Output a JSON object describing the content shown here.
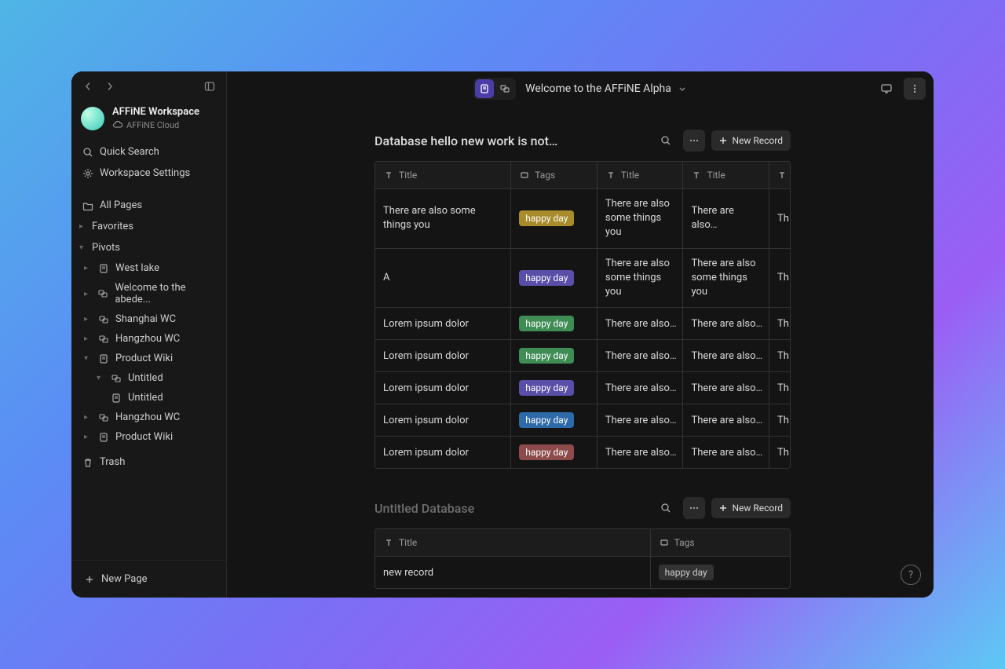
{
  "workspace": {
    "name": "AFFiNE Workspace",
    "sub": "AFFiNE Cloud"
  },
  "sidebar": {
    "quick_search": "Quick Search",
    "settings": "Workspace Settings",
    "all_pages": "All Pages",
    "favorites": "Favorites",
    "pivots": "Pivots",
    "pivot_items": [
      {
        "label": "West lake",
        "icon": "doc"
      },
      {
        "label": "Welcome to the abede...",
        "icon": "edgeless"
      },
      {
        "label": "Shanghai WC",
        "icon": "edgeless"
      },
      {
        "label": "Hangzhou WC",
        "icon": "edgeless"
      },
      {
        "label": "Product Wiki",
        "icon": "doc",
        "expanded": true,
        "children": [
          {
            "label": "Untitled",
            "icon": "edgeless"
          },
          {
            "label": "Untitled",
            "icon": "doc"
          }
        ]
      },
      {
        "label": "Hangzhou WC",
        "icon": "edgeless"
      },
      {
        "label": "Product Wiki",
        "icon": "doc"
      }
    ],
    "trash": "Trash",
    "new_page": "New Page"
  },
  "topbar": {
    "title": "Welcome to the AFFiNE Alpha"
  },
  "db1": {
    "title": "Database hello new work is not…",
    "new_record": "New Record",
    "columns": [
      "Title",
      "Tags",
      "Title",
      "Title",
      "Th"
    ],
    "col_types": [
      "text",
      "tag",
      "text",
      "text",
      "text"
    ],
    "rows": [
      {
        "c0": "There are also some things you",
        "tag": "happy day",
        "tag_color": "#a88b2a",
        "c2": "There are also some things you",
        "c3": "There are also…",
        "c4": "Th"
      },
      {
        "c0": "A",
        "tag": "happy day",
        "tag_color": "#5a4fa8",
        "c2": "There are also some things you",
        "c3": "There are also some things you",
        "c4": "Th"
      },
      {
        "c0": "Lorem ipsum dolor",
        "tag": "happy day",
        "tag_color": "#3f8d55",
        "c2": "There are also…",
        "c3": "There are also…",
        "c4": "Th"
      },
      {
        "c0": "Lorem ipsum dolor",
        "tag": "happy day",
        "tag_color": "#3f8d55",
        "c2": "There are also…",
        "c3": "There are also…",
        "c4": "Th"
      },
      {
        "c0": "Lorem ipsum dolor",
        "tag": "happy day",
        "tag_color": "#5a4fa8",
        "c2": "There are also…",
        "c3": "There are also…",
        "c4": "Th"
      },
      {
        "c0": "Lorem ipsum dolor",
        "tag": "happy day",
        "tag_color": "#2e6aa8",
        "c2": "There are also…",
        "c3": "There are also…",
        "c4": "Th"
      },
      {
        "c0": "Lorem ipsum dolor",
        "tag": "happy day",
        "tag_color": "#8d4a4a",
        "c2": "There are also…",
        "c3": "There are also…",
        "c4": "Th"
      }
    ]
  },
  "db2": {
    "title": "Untitled Database",
    "new_record": "New Record",
    "columns": [
      "Title",
      "Tags"
    ],
    "rows": [
      {
        "c0": "new record",
        "tag": "happy day"
      }
    ]
  }
}
